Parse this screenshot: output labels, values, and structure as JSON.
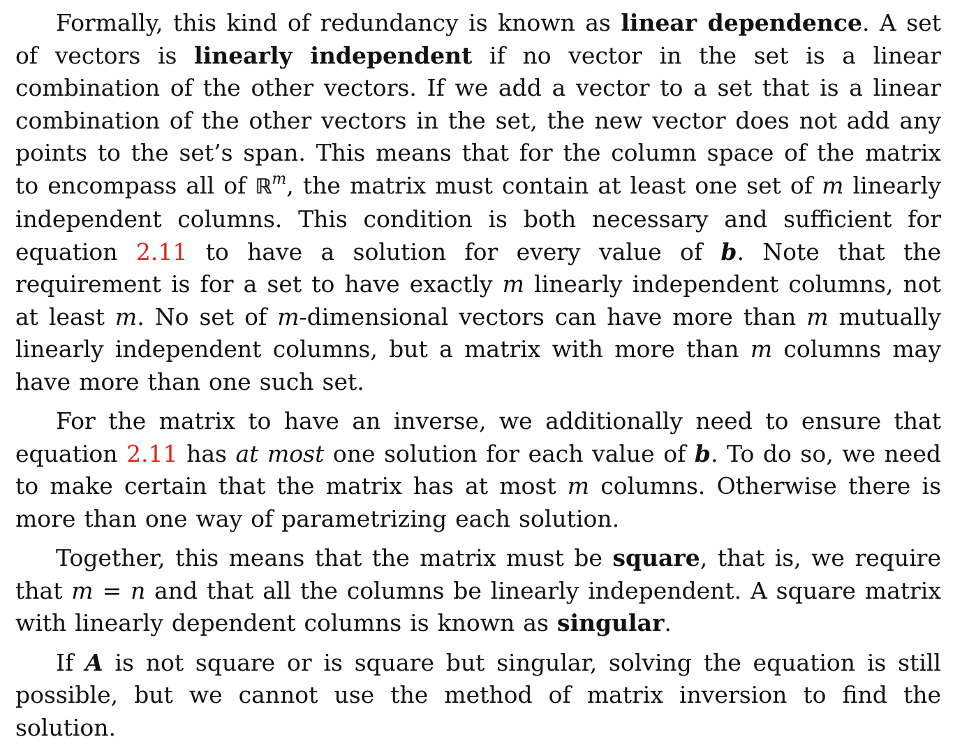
{
  "p1": {
    "s01": "Formally, this kind of redundancy is known as ",
    "t_linear_dependence": "linear dependence",
    "s02": ". A set of vectors is ",
    "t_linearly_independent": "linearly independent",
    "s03": " if no vector in the set is a linear combination of the other vectors. If we add a vector to a set that is a linear combination of the other vectors in the set, the new vector does not add any points to the set’s span. This means that for the column space of the matrix to encompass all of ",
    "reals": "ℝ",
    "m_exp": "m",
    "s04": ", the matrix must contain at least one set of ",
    "m1": "m",
    "s05": " linearly independent columns. This condition is both necessary and sufficient for equation ",
    "ref1": "2.11",
    "s06": " to have a solution for every value of ",
    "b1": "b",
    "s07": ". Note that the requirement is for a set to have exactly ",
    "m2": "m",
    "s08": " linearly independent columns, not at least ",
    "m3": "m",
    "s09": ". No set of ",
    "m4": "m",
    "s10": "-dimensional vectors can have more than ",
    "m5": "m",
    "s11": " mutually linearly independent columns, but a matrix with more than ",
    "m6": "m",
    "s12": " columns may have more than one such set."
  },
  "p2": {
    "s01": "For the matrix to have an inverse, we additionally need to ensure that equa­tion ",
    "ref2": "2.11",
    "s02": " has ",
    "at_most": "at most",
    "s03": " one solution for each value of ",
    "b2": "b",
    "s04": ". To do so, we need to make certain that the matrix has at most ",
    "m7": "m",
    "s05": " columns. Otherwise there is more than one way of parametrizing each solution."
  },
  "p3": {
    "s01": "Together, this means that the matrix must be ",
    "square": "square",
    "s02": ", that is, we require that ",
    "m8": "m",
    "eq": " = ",
    "n1": "n",
    "s03": " and that all the columns be linearly independent. A square matrix with linearly dependent columns is known as ",
    "singular": "singular",
    "s04": "."
  },
  "p4": {
    "s01": "If ",
    "A": "A",
    "s02": " is not square or is square but singular, solving the equation is still possible, but we cannot use the method of matrix inversion to find the solution."
  }
}
